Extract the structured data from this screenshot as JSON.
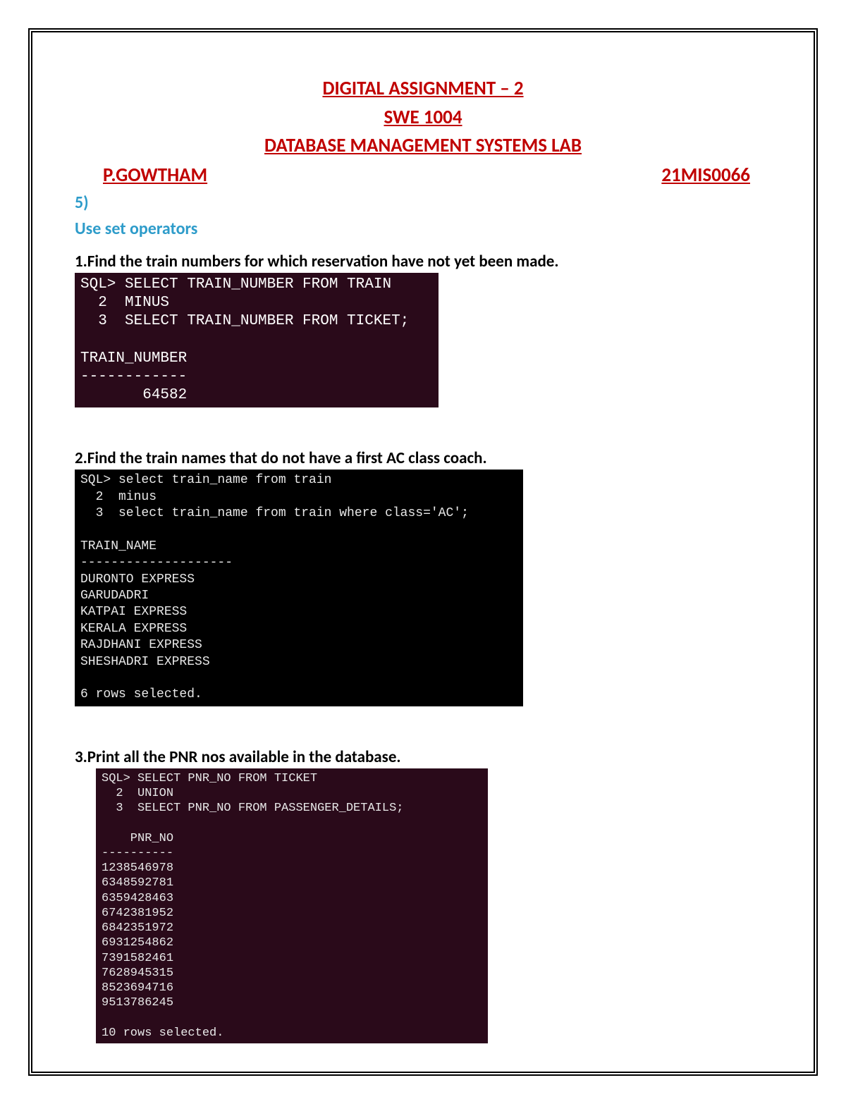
{
  "header": {
    "title1": "DIGITAL ASSIGNMENT – 2",
    "title2": "SWE 1004",
    "title3": "DATABASE MANAGEMENT SYSTEMS LAB",
    "name": "P.GOWTHAM",
    "regno": "21MIS0066"
  },
  "section": {
    "num": "5)",
    "title": "Use set operators"
  },
  "q1": {
    "text": "1.Find the train numbers for which reservation have not yet been made.",
    "terminal": "SQL> SELECT TRAIN_NUMBER FROM TRAIN\n  2  MINUS\n  3  SELECT TRAIN_NUMBER FROM TICKET;\n\nTRAIN_NUMBER\n------------\n       64582"
  },
  "q2": {
    "text": "2.Find the train names that do not have a first AC class coach.",
    "terminal": "SQL> select train_name from train\n  2  minus\n  3  select train_name from train where class='AC';\n\nTRAIN_NAME\n--------------------\nDURONTO EXPRESS\nGARUDADRI\nKATPAI EXPRESS\nKERALA EXPRESS\nRAJDHANI EXPRESS\nSHESHADRI EXPRESS\n\n6 rows selected."
  },
  "q3": {
    "text": "3.Print all the PNR nos available in the database.",
    "terminal": "SQL> SELECT PNR_NO FROM TICKET\n  2  UNION\n  3  SELECT PNR_NO FROM PASSENGER_DETAILS;\n\n    PNR_NO\n----------\n1238546978\n6348592781\n6359428463\n6742381952\n6842351972\n6931254862\n7391582461\n7628945315\n8523694716\n9513786245\n\n10 rows selected."
  }
}
